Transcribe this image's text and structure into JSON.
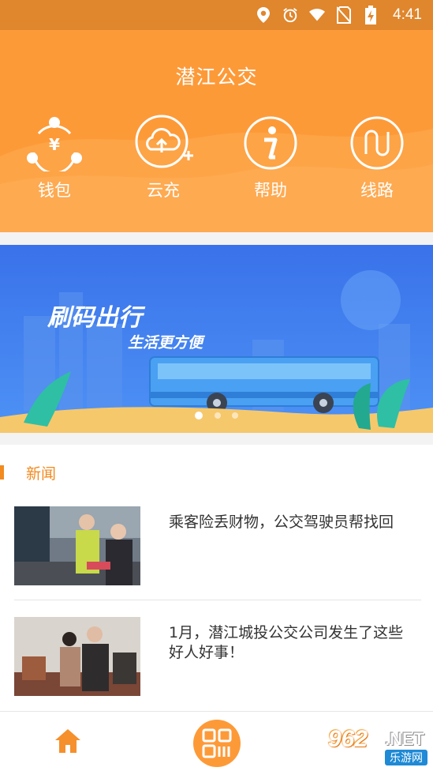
{
  "status_bar": {
    "time": "4:41",
    "icons": [
      "location-icon",
      "alarm-icon",
      "wifi-icon",
      "no-sim-icon",
      "battery-charging-icon"
    ]
  },
  "header": {
    "title": "潜江公交",
    "items": [
      {
        "label": "钱包",
        "icon": "wallet-yuan-icon"
      },
      {
        "label": "云充",
        "icon": "cloud-recharge-icon"
      },
      {
        "label": "帮助",
        "icon": "info-icon"
      },
      {
        "label": "线路",
        "icon": "route-icon"
      }
    ]
  },
  "banner": {
    "title": "刷码出行",
    "subtitle": "生活更方便",
    "slides": 3,
    "active_slide": 0
  },
  "news": {
    "section_title": "新闻",
    "items": [
      {
        "title": "乘客险丢财物，公交驾驶员帮找回"
      },
      {
        "title": "1月，潜江城投公交公司发生了这些好人好事！"
      }
    ]
  },
  "bottom_nav": {
    "items": [
      "home-icon",
      "qr-scan-icon"
    ]
  },
  "watermark": {
    "number": "962",
    "suffix": ".NET",
    "site": "乐游网"
  },
  "colors": {
    "accent": "#fd9a38",
    "status_bar": "#e0862c",
    "banner": "#3c7ff0",
    "news_accent": "#f28a1f"
  }
}
